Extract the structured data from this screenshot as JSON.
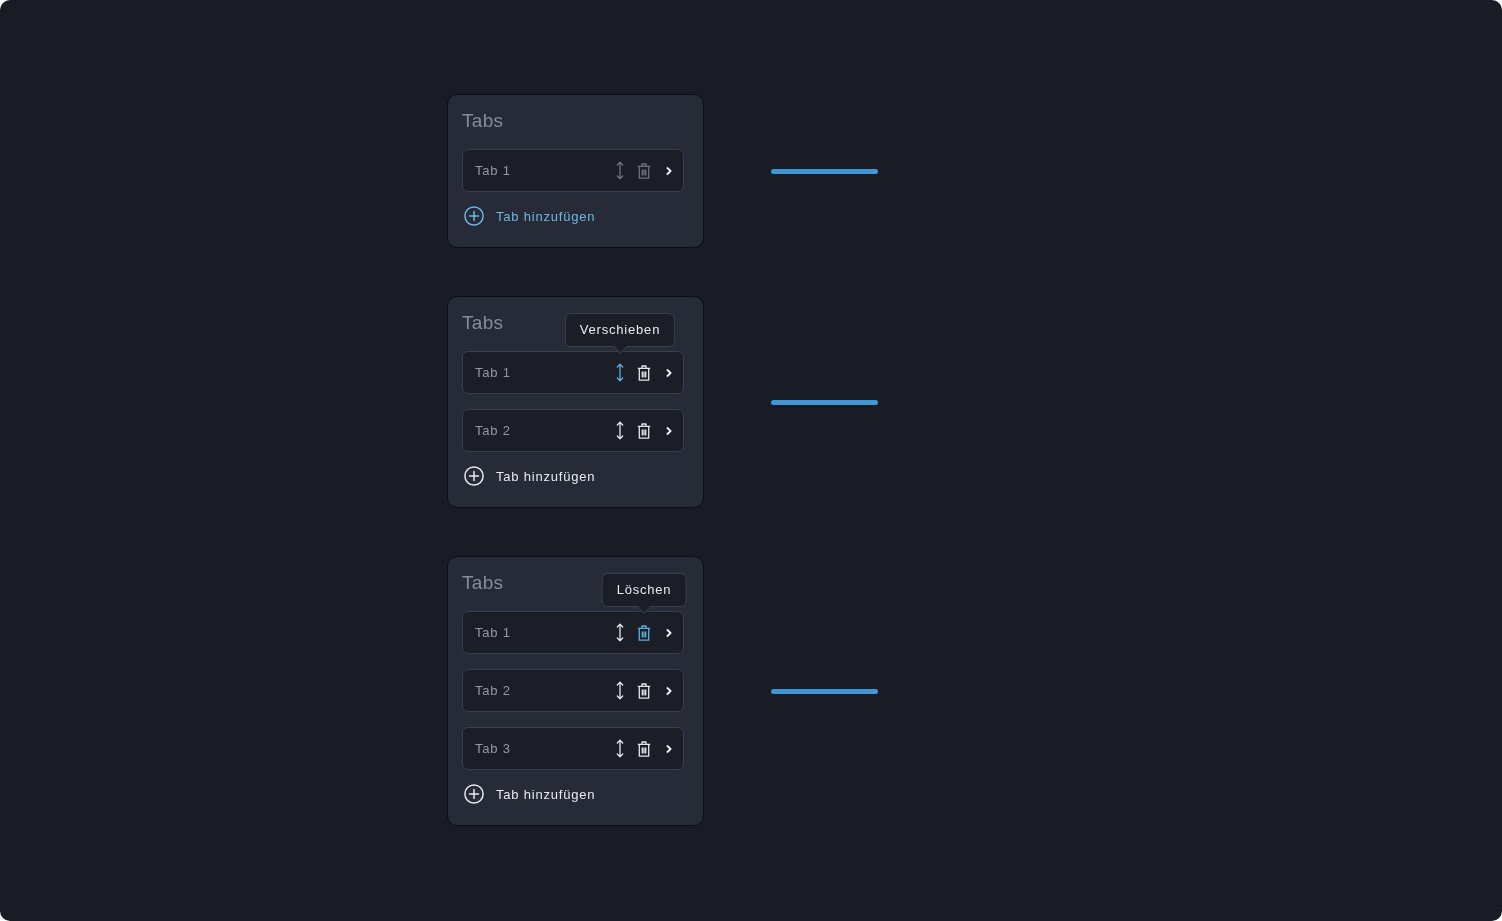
{
  "panels": [
    {
      "title": "Tabs",
      "tabs": [
        {
          "label": "Tab 1",
          "actions_disabled": true,
          "move_active": false,
          "delete_active": false
        }
      ],
      "add_button": {
        "label": "Tab hinzufügen",
        "highlighted": true
      }
    },
    {
      "title": "Tabs",
      "tabs": [
        {
          "label": "Tab 1",
          "actions_disabled": false,
          "move_active": true,
          "delete_active": false,
          "tooltip": "Verschieben"
        },
        {
          "label": "Tab 2",
          "actions_disabled": false,
          "move_active": false,
          "delete_active": false
        }
      ],
      "add_button": {
        "label": "Tab hinzufügen",
        "highlighted": false
      }
    },
    {
      "title": "Tabs",
      "tabs": [
        {
          "label": "Tab 1",
          "actions_disabled": false,
          "move_active": false,
          "delete_active": true,
          "tooltip": "Löschen"
        },
        {
          "label": "Tab 2",
          "actions_disabled": false,
          "move_active": false,
          "delete_active": false
        },
        {
          "label": "Tab 3",
          "actions_disabled": false,
          "move_active": false,
          "delete_active": false
        }
      ],
      "add_button": {
        "label": "Tab hinzufügen",
        "highlighted": false
      }
    }
  ]
}
